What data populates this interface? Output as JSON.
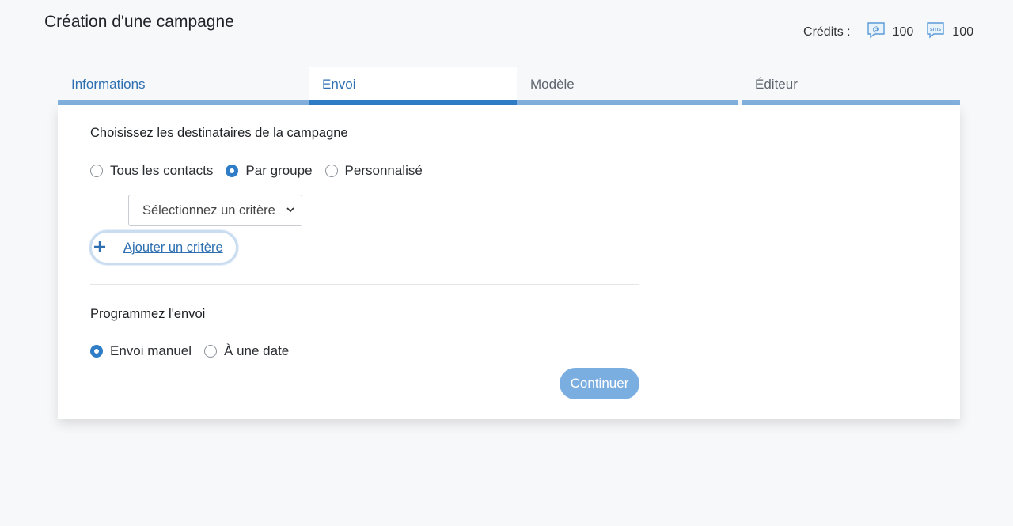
{
  "header": {
    "title": "Création d'une campagne",
    "credits_label": "Crédits :",
    "email_credits": "100",
    "sms_credits": "100",
    "sms_icon_text": "sms",
    "email_icon_text": "@"
  },
  "tabs": [
    {
      "label": "Informations",
      "active": false
    },
    {
      "label": "Envoi",
      "active": true
    },
    {
      "label": "Modèle",
      "active": false
    },
    {
      "label": "Éditeur",
      "active": false
    }
  ],
  "recipients": {
    "title": "Choisissez les destinataires de la campagne",
    "options": [
      {
        "label": "Tous les contacts",
        "checked": false
      },
      {
        "label": "Par groupe",
        "checked": true
      },
      {
        "label": "Personnalisé",
        "checked": false
      }
    ],
    "select_value": "Sélectionnez un critère",
    "add_criterion_label": "Ajouter un critère"
  },
  "schedule": {
    "title": "Programmez l'envoi",
    "options": [
      {
        "label": "Envoi manuel",
        "checked": true
      },
      {
        "label": "À une date",
        "checked": false
      }
    ]
  },
  "actions": {
    "continue_label": "Continuer"
  },
  "colors": {
    "accent": "#2f7cc7",
    "tab_bar": "#82b1de",
    "button": "#7aaee0",
    "background": "#f7f8fa"
  }
}
